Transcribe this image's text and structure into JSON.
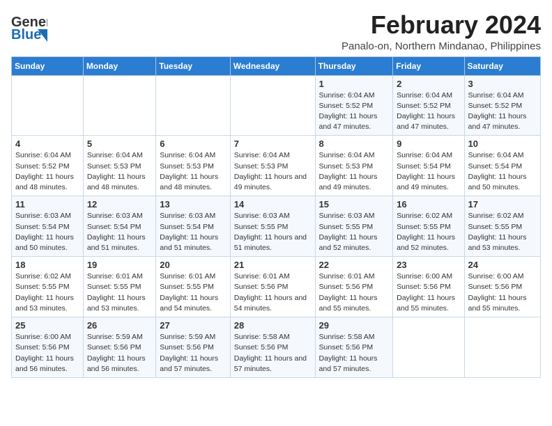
{
  "logo": {
    "part1": "General",
    "part2": "Blue"
  },
  "title": {
    "month_year": "February 2024",
    "location": "Panalo-on, Northern Mindanao, Philippines"
  },
  "headers": [
    "Sunday",
    "Monday",
    "Tuesday",
    "Wednesday",
    "Thursday",
    "Friday",
    "Saturday"
  ],
  "weeks": [
    [
      {
        "day": "",
        "info": ""
      },
      {
        "day": "",
        "info": ""
      },
      {
        "day": "",
        "info": ""
      },
      {
        "day": "",
        "info": ""
      },
      {
        "day": "1",
        "info": "Sunrise: 6:04 AM\nSunset: 5:52 PM\nDaylight: 11 hours\nand 47 minutes."
      },
      {
        "day": "2",
        "info": "Sunrise: 6:04 AM\nSunset: 5:52 PM\nDaylight: 11 hours\nand 47 minutes."
      },
      {
        "day": "3",
        "info": "Sunrise: 6:04 AM\nSunset: 5:52 PM\nDaylight: 11 hours\nand 47 minutes."
      }
    ],
    [
      {
        "day": "4",
        "info": "Sunrise: 6:04 AM\nSunset: 5:52 PM\nDaylight: 11 hours\nand 48 minutes."
      },
      {
        "day": "5",
        "info": "Sunrise: 6:04 AM\nSunset: 5:53 PM\nDaylight: 11 hours\nand 48 minutes."
      },
      {
        "day": "6",
        "info": "Sunrise: 6:04 AM\nSunset: 5:53 PM\nDaylight: 11 hours\nand 48 minutes."
      },
      {
        "day": "7",
        "info": "Sunrise: 6:04 AM\nSunset: 5:53 PM\nDaylight: 11 hours\nand 49 minutes."
      },
      {
        "day": "8",
        "info": "Sunrise: 6:04 AM\nSunset: 5:53 PM\nDaylight: 11 hours\nand 49 minutes."
      },
      {
        "day": "9",
        "info": "Sunrise: 6:04 AM\nSunset: 5:54 PM\nDaylight: 11 hours\nand 49 minutes."
      },
      {
        "day": "10",
        "info": "Sunrise: 6:04 AM\nSunset: 5:54 PM\nDaylight: 11 hours\nand 50 minutes."
      }
    ],
    [
      {
        "day": "11",
        "info": "Sunrise: 6:03 AM\nSunset: 5:54 PM\nDaylight: 11 hours\nand 50 minutes."
      },
      {
        "day": "12",
        "info": "Sunrise: 6:03 AM\nSunset: 5:54 PM\nDaylight: 11 hours\nand 51 minutes."
      },
      {
        "day": "13",
        "info": "Sunrise: 6:03 AM\nSunset: 5:54 PM\nDaylight: 11 hours\nand 51 minutes."
      },
      {
        "day": "14",
        "info": "Sunrise: 6:03 AM\nSunset: 5:55 PM\nDaylight: 11 hours\nand 51 minutes."
      },
      {
        "day": "15",
        "info": "Sunrise: 6:03 AM\nSunset: 5:55 PM\nDaylight: 11 hours\nand 52 minutes."
      },
      {
        "day": "16",
        "info": "Sunrise: 6:02 AM\nSunset: 5:55 PM\nDaylight: 11 hours\nand 52 minutes."
      },
      {
        "day": "17",
        "info": "Sunrise: 6:02 AM\nSunset: 5:55 PM\nDaylight: 11 hours\nand 53 minutes."
      }
    ],
    [
      {
        "day": "18",
        "info": "Sunrise: 6:02 AM\nSunset: 5:55 PM\nDaylight: 11 hours\nand 53 minutes."
      },
      {
        "day": "19",
        "info": "Sunrise: 6:01 AM\nSunset: 5:55 PM\nDaylight: 11 hours\nand 53 minutes."
      },
      {
        "day": "20",
        "info": "Sunrise: 6:01 AM\nSunset: 5:55 PM\nDaylight: 11 hours\nand 54 minutes."
      },
      {
        "day": "21",
        "info": "Sunrise: 6:01 AM\nSunset: 5:56 PM\nDaylight: 11 hours\nand 54 minutes."
      },
      {
        "day": "22",
        "info": "Sunrise: 6:01 AM\nSunset: 5:56 PM\nDaylight: 11 hours\nand 55 minutes."
      },
      {
        "day": "23",
        "info": "Sunrise: 6:00 AM\nSunset: 5:56 PM\nDaylight: 11 hours\nand 55 minutes."
      },
      {
        "day": "24",
        "info": "Sunrise: 6:00 AM\nSunset: 5:56 PM\nDaylight: 11 hours\nand 55 minutes."
      }
    ],
    [
      {
        "day": "25",
        "info": "Sunrise: 6:00 AM\nSunset: 5:56 PM\nDaylight: 11 hours\nand 56 minutes."
      },
      {
        "day": "26",
        "info": "Sunrise: 5:59 AM\nSunset: 5:56 PM\nDaylight: 11 hours\nand 56 minutes."
      },
      {
        "day": "27",
        "info": "Sunrise: 5:59 AM\nSunset: 5:56 PM\nDaylight: 11 hours\nand 57 minutes."
      },
      {
        "day": "28",
        "info": "Sunrise: 5:58 AM\nSunset: 5:56 PM\nDaylight: 11 hours\nand 57 minutes."
      },
      {
        "day": "29",
        "info": "Sunrise: 5:58 AM\nSunset: 5:56 PM\nDaylight: 11 hours\nand 57 minutes."
      },
      {
        "day": "",
        "info": ""
      },
      {
        "day": "",
        "info": ""
      }
    ]
  ]
}
